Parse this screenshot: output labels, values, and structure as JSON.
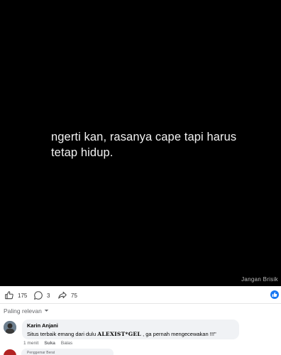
{
  "post": {
    "quote_line1": "ngerti kan, rasanya cape tapi harus",
    "quote_line2": "tetap hidup.",
    "watermark": "Jangan Brisik"
  },
  "actions": {
    "likes": "175",
    "comments": "3",
    "shares": "75"
  },
  "colors": {
    "accent": "#1877f2",
    "media_bg": "#000000",
    "bubble_bg": "#f0f2f5",
    "muted_text": "#65676b"
  },
  "comments": {
    "sort_label": "Paling relevan",
    "items": [
      {
        "author": "Karin Anjani",
        "text_before": "Situs terbaik emang dari dulu ",
        "brand": "ALEXIST*GEL",
        "text_after": " , ga pernah mengecewakan !!!\"",
        "time": "1 menit",
        "like_label": "Suka",
        "reply_label": "Balas"
      }
    ],
    "partial_badge": "Penggemar Berat"
  }
}
